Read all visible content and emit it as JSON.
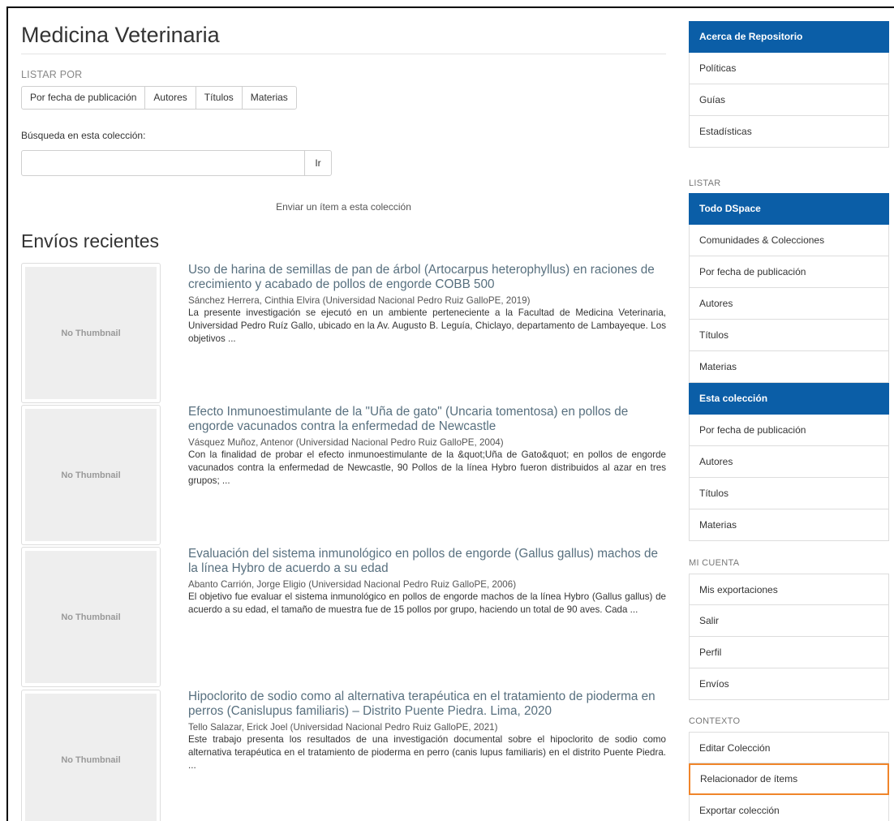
{
  "page": {
    "title": "Medicina Veterinaria",
    "browse_label": "LISTAR POR",
    "browse_buttons": [
      "Por fecha de publicación",
      "Autores",
      "Títulos",
      "Materias"
    ],
    "search_label": "Búsqueda en esta colección:",
    "search_value": "",
    "search_button": "Ir",
    "submit_link": "Enviar un ítem a esta colección",
    "recent_title": "Envíos recientes"
  },
  "items": [
    {
      "thumbnail": "No Thumbnail",
      "title": "Uso de harina de semillas de pan de árbol (Artocarpus heterophyllus) en raciones de crecimiento y acabado de pollos de engorde COBB 500",
      "meta": "Sánchez Herrera, Cinthia Elvira (Universidad Nacional Pedro Ruiz GalloPE, 2019)",
      "abstract": "La presente investigación se ejecutó en un ambiente perteneciente a la Facultad de Medicina Veterinaria, Universidad Pedro Ruíz Gallo, ubicado en la Av. Augusto B. Leguía, Chiclayo, departamento de Lambayeque. Los objetivos ..."
    },
    {
      "thumbnail": "No Thumbnail",
      "title": "Efecto Inmunoestimulante de la \"Uña de gato\" (Uncaria tomentosa) en pollos de engorde vacunados contra la enfermedad de Newcastle",
      "meta": "Vásquez Muñoz, Antenor (Universidad Nacional Pedro Ruiz GalloPE, 2004)",
      "abstract": "Con la finalidad de probar el efecto inmunoestimulante de la &quot;Uña de Gato&quot; en pollos de engorde vacunados contra la enfermedad de Newcastle, 90 Pollos de la línea Hybro fueron distribuidos al azar en tres grupos; ..."
    },
    {
      "thumbnail": "No Thumbnail",
      "title": "Evaluación del sistema inmunológico en pollos de engorde (Gallus gallus) machos de la línea Hybro de acuerdo a su edad",
      "meta": "Abanto Carrión, Jorge Eligio (Universidad Nacional Pedro Ruiz GalloPE, 2006)",
      "abstract": "El objetivo fue evaluar el sistema inmunológico en pollos de engorde machos de la línea Hybro (Gallus gallus) de acuerdo a su edad, el tamaño de muestra fue de 15 pollos por grupo, haciendo un total de 90 aves. Cada ..."
    },
    {
      "thumbnail": "No Thumbnail",
      "title": "Hipoclorito de sodio como al alternativa terapéutica en el tratamiento de pioderma en perros (Canislupus familiaris) – Distrito Puente Piedra. Lima, 2020",
      "meta": "Tello Salazar, Erick Joel (Universidad Nacional Pedro Ruiz GalloPE, 2021)",
      "abstract": "Este trabajo presenta los resultados de una investigación documental sobre el hipoclorito de sodio como alternativa terapéutica en el tratamiento de pioderma en perro (canis lupus familiaris) en el distrito Puente Piedra. ..."
    }
  ],
  "sidebar": {
    "about": {
      "header": "Acerca de Repositorio",
      "items": [
        "Políticas",
        "Guías",
        "Estadísticas"
      ]
    },
    "browse": {
      "label": "LISTAR",
      "all_header": "Todo DSpace",
      "all_items": [
        "Comunidades & Colecciones",
        "Por fecha de publicación",
        "Autores",
        "Títulos",
        "Materias"
      ],
      "collection_header": "Esta colección",
      "collection_items": [
        "Por fecha de publicación",
        "Autores",
        "Títulos",
        "Materias"
      ]
    },
    "account": {
      "label": "MI CUENTA",
      "items": [
        "Mis exportaciones",
        "Salir",
        "Perfil",
        "Envíos"
      ]
    },
    "context": {
      "label": "CONTEXTO",
      "items": [
        "Editar Colección",
        "Relacionador de ítems",
        "Exportar colección"
      ]
    }
  },
  "colors": {
    "sidebar_header": "#0b5ea7",
    "highlight": "#f0852a",
    "item_title": "#58707f"
  }
}
